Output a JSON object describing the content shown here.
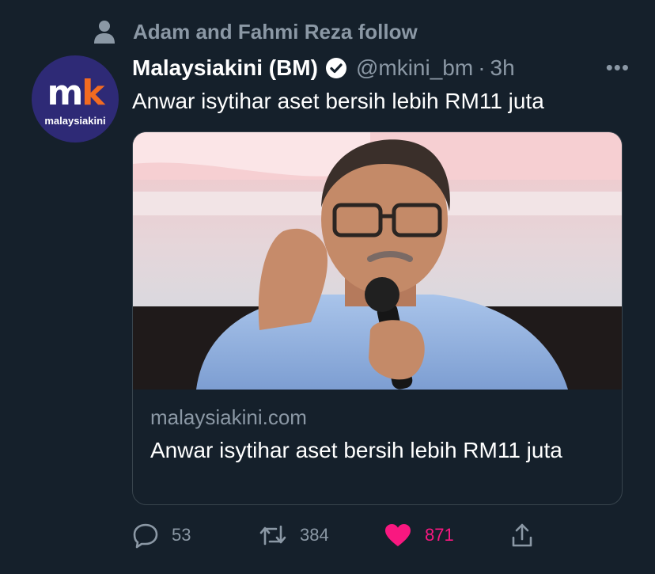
{
  "social_context": {
    "text": "Adam and Fahmi Reza follow"
  },
  "tweet": {
    "avatar": {
      "logo_m": "m",
      "logo_k": "k",
      "brand_text": "malaysiakini"
    },
    "display_name": "Malaysiakini (BM)",
    "handle": "@mkini_bm",
    "separator": "·",
    "timestamp": "3h",
    "more_label": "•••",
    "text": "Anwar isytihar aset bersih lebih RM11 juta",
    "card": {
      "domain": "malaysiakini.com",
      "title": "Anwar isytihar aset bersih lebih RM11 juta"
    },
    "actions": {
      "reply_count": "53",
      "retweet_count": "384",
      "like_count": "871"
    }
  },
  "colors": {
    "background": "#15202b",
    "secondary_text": "#8b98a5",
    "like": "#f91880",
    "brand_purple": "#2e2a76",
    "brand_orange": "#f26b21"
  },
  "icons": [
    "person-icon",
    "verified-badge-icon",
    "more-icon",
    "reply-icon",
    "retweet-icon",
    "like-icon",
    "share-icon"
  ]
}
